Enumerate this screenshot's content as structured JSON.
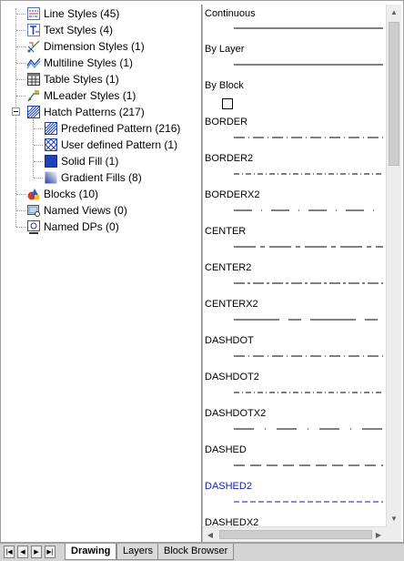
{
  "tree": {
    "items": [
      {
        "label": "Line Styles (45)",
        "icon": "line-styles-icon"
      },
      {
        "label": "Text Styles (4)",
        "icon": "text-styles-icon"
      },
      {
        "label": "Dimension Styles (1)",
        "icon": "dimension-styles-icon"
      },
      {
        "label": "Multiline Styles (1)",
        "icon": "multiline-styles-icon"
      },
      {
        "label": "Table Styles (1)",
        "icon": "table-styles-icon"
      },
      {
        "label": "MLeader Styles (1)",
        "icon": "mleader-styles-icon"
      },
      {
        "label": "Hatch Patterns (217)",
        "icon": "hatch-patterns-icon",
        "expanded": true
      },
      {
        "label": "Predefined Pattern (216)",
        "icon": "predefined-pattern-icon"
      },
      {
        "label": "User defined Pattern (1)",
        "icon": "user-defined-pattern-icon"
      },
      {
        "label": "Solid Fill (1)",
        "icon": "solid-fill-icon"
      },
      {
        "label": "Gradient Fills (8)",
        "icon": "gradient-fills-icon"
      },
      {
        "label": "Blocks (10)",
        "icon": "blocks-icon"
      },
      {
        "label": "Named Views (0)",
        "icon": "named-views-icon"
      },
      {
        "label": "Named DPs (0)",
        "icon": "named-dps-icon"
      }
    ]
  },
  "preview": {
    "linestyles": [
      {
        "name": "Continuous",
        "dash": "solid"
      },
      {
        "name": "By Layer",
        "dash": "solid"
      },
      {
        "name": "By Block",
        "dash": "box"
      },
      {
        "name": "BORDER",
        "dash": "border"
      },
      {
        "name": "BORDER2",
        "dash": "border2"
      },
      {
        "name": "BORDERX2",
        "dash": "borderx2"
      },
      {
        "name": "CENTER",
        "dash": "center"
      },
      {
        "name": "CENTER2",
        "dash": "center2"
      },
      {
        "name": "CENTERX2",
        "dash": "centerx2"
      },
      {
        "name": "DASHDOT",
        "dash": "dashdot"
      },
      {
        "name": "DASHDOT2",
        "dash": "dashdot2"
      },
      {
        "name": "DASHDOTX2",
        "dash": "dashdotx2"
      },
      {
        "name": "DASHED",
        "dash": "dashed"
      },
      {
        "name": "DASHED2",
        "dash": "dashed2",
        "selected": true
      },
      {
        "name": "DASHEDX2",
        "dash": "dashedx2"
      }
    ],
    "selected_color": "#1a1aa8"
  },
  "tabs": [
    {
      "label": "Drawing",
      "active": true
    },
    {
      "label": "Layers",
      "active": false
    },
    {
      "label": "Block Browser",
      "active": false
    }
  ]
}
